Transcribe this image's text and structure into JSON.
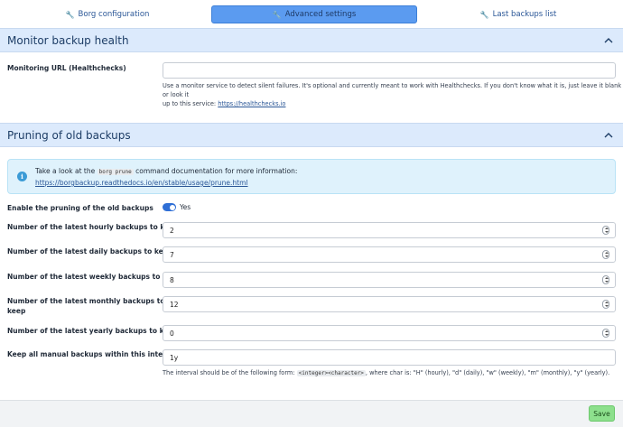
{
  "tabs": [
    {
      "label": "Borg configuration",
      "icon": "wrench-icon",
      "active": false
    },
    {
      "label": "Advanced settings",
      "icon": "wrench-icon",
      "active": true
    },
    {
      "label": "Last backups list",
      "icon": "wrench-icon",
      "active": false
    }
  ],
  "monitor": {
    "title": "Monitor backup health",
    "url_label": "Monitoring URL (Healthchecks)",
    "url_value": "",
    "help_line1": "Use a monitor service to detect silent failures. It's optional and currently meant to work with Healthchecks. If you don't know what it is, just leave it blank or look it",
    "help_line2_prefix": "up to this service: ",
    "help_link": "https://healthchecks.io"
  },
  "pruning": {
    "title": "Pruning of old backups",
    "info_prefix": "Take a look at the ",
    "info_code": "borg prune",
    "info_suffix": " command documentation for more information:",
    "info_link": "https://borgbackup.readthedocs.io/en/stable/usage/prune.html",
    "enable_label": "Enable the pruning of the old backups",
    "enable_value": "Yes",
    "hourly_label": "Number of the latest hourly backups to keep",
    "hourly_value": "2",
    "daily_label": "Number of the latest daily backups to keep",
    "daily_value": "7",
    "weekly_label": "Number of the latest weekly backups to keep",
    "weekly_value": "8",
    "monthly_label_line1": "Number of the latest monthly backups to",
    "monthly_label_line2": "keep",
    "monthly_value": "12",
    "yearly_label": "Number of the latest yearly backups to keep",
    "yearly_value": "0",
    "manual_label": "Keep all manual backups within this interval",
    "manual_value": "1y",
    "interval_help_prefix": "The interval should be of the following form: ",
    "interval_help_code": "<integer><character>",
    "interval_help_suffix": ", where char is: \"H\" (hourly), \"d\" (daily), \"w\" (weekly), \"m\" (monthly), \"y\" (yearly)."
  },
  "footer": {
    "save_label": "Save"
  },
  "colors": {
    "accent": "#5b9bf0",
    "section_header": "#dceafc",
    "save_button": "#8de08d"
  }
}
